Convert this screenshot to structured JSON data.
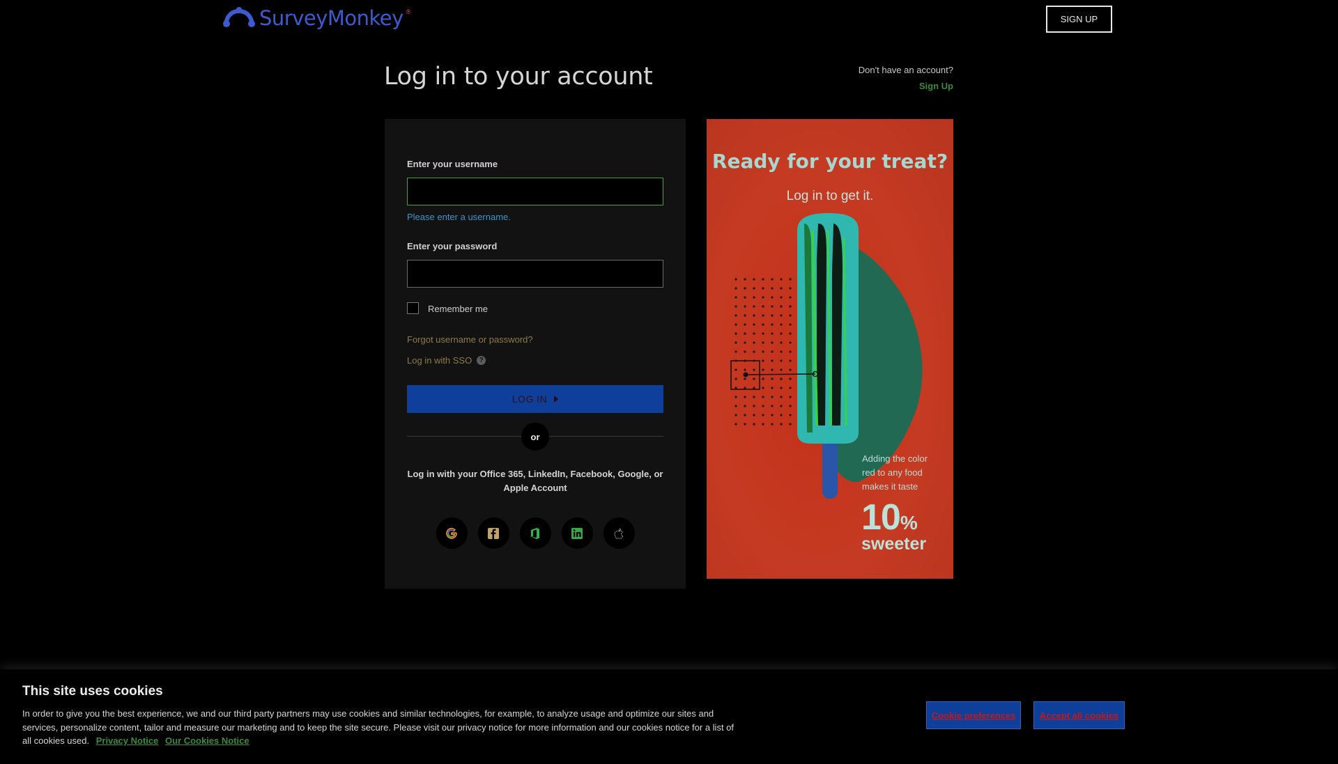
{
  "header": {
    "logo_text": "SurveyMonkey",
    "logo_reg": "®",
    "signup_label": "SIGN UP"
  },
  "title": {
    "heading": "Log in to your account",
    "no_account": "Don't have an account?",
    "sign_up_link": "Sign Up"
  },
  "form": {
    "username_label": "Enter your username",
    "username_value": "",
    "username_error": "Please enter a username.",
    "password_label": "Enter your password",
    "password_value": "",
    "remember_label": "Remember me",
    "remember_checked": false,
    "forgot_link": "Forgot username or password?",
    "sso_link": "Log in with SSO",
    "sso_help_glyph": "?",
    "login_button": "LOG IN",
    "or_label": "or",
    "social_text": "Log in with your Office 365, LinkedIn, Facebook, Google, or Apple Account",
    "social_buttons": [
      {
        "icon": "google-icon"
      },
      {
        "icon": "facebook-icon"
      },
      {
        "icon": "office365-icon"
      },
      {
        "icon": "linkedin-icon"
      },
      {
        "icon": "apple-icon"
      }
    ]
  },
  "promo": {
    "title": "Ready for your treat?",
    "subtitle": "Log in to get it.",
    "fact_text": "Adding the color red to any food makes it taste",
    "fact_number": "10",
    "fact_percent": "%",
    "fact_word": "sweeter"
  },
  "cookie": {
    "title": "This site uses cookies",
    "body": "In order to give you the best experience, we and our third party partners may use cookies and similar technologies, for example, to analyze usage and optimize our sites and services, personalize content, tailor and measure our marketing and to keep the site secure. Please visit our privacy notice for more information and our cookies notice for a list of all cookies used.",
    "privacy_link": "Privacy Notice",
    "cookies_link": "Our Cookies Notice",
    "preferences_button": "Cookie preferences",
    "accept_button": "Accept all cookies"
  },
  "colors": {
    "background": "#000000",
    "card": "#121212",
    "primary_button": "#0d3f9b",
    "link_green": "#3f8a3f",
    "error_blue": "#3e94c9",
    "promo_red": "#c53a22",
    "promo_text": "#a8d7cf"
  }
}
